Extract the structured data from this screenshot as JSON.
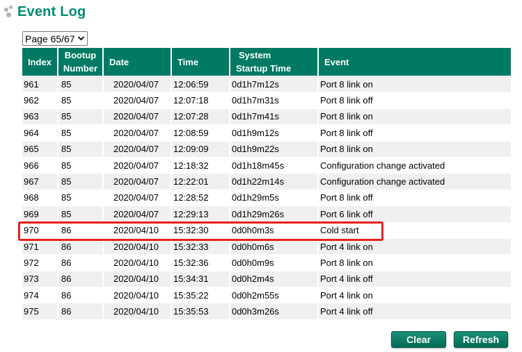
{
  "page": {
    "title": "Event Log"
  },
  "pager": {
    "selected": "Page 65/67"
  },
  "table": {
    "headers": {
      "index": "Index",
      "bootup_1": "Bootup",
      "bootup_2": "Number",
      "date": "Date",
      "time": "Time",
      "system_1": "System",
      "system_2": "Startup Time",
      "event": "Event"
    },
    "rows": [
      {
        "index": "961",
        "bootup": "85",
        "date": "2020/04/07",
        "time": "12:06:59",
        "startup": "0d1h7m12s",
        "event": "Port 8 link on"
      },
      {
        "index": "962",
        "bootup": "85",
        "date": "2020/04/07",
        "time": "12:07:18",
        "startup": "0d1h7m31s",
        "event": "Port 8 link off"
      },
      {
        "index": "963",
        "bootup": "85",
        "date": "2020/04/07",
        "time": "12:07:28",
        "startup": "0d1h7m41s",
        "event": "Port 8 link on"
      },
      {
        "index": "964",
        "bootup": "85",
        "date": "2020/04/07",
        "time": "12:08:59",
        "startup": "0d1h9m12s",
        "event": "Port 8 link off"
      },
      {
        "index": "965",
        "bootup": "85",
        "date": "2020/04/07",
        "time": "12:09:09",
        "startup": "0d1h9m22s",
        "event": "Port 8 link on"
      },
      {
        "index": "966",
        "bootup": "85",
        "date": "2020/04/07",
        "time": "12:18:32",
        "startup": "0d1h18m45s",
        "event": "Configuration change activated"
      },
      {
        "index": "967",
        "bootup": "85",
        "date": "2020/04/07",
        "time": "12:22:01",
        "startup": "0d1h22m14s",
        "event": "Configuration change activated"
      },
      {
        "index": "968",
        "bootup": "85",
        "date": "2020/04/07",
        "time": "12:28:52",
        "startup": "0d1h29m5s",
        "event": "Port 8 link off"
      },
      {
        "index": "969",
        "bootup": "85",
        "date": "2020/04/07",
        "time": "12:29:13",
        "startup": "0d1h29m26s",
        "event": "Port 6 link off"
      },
      {
        "index": "970",
        "bootup": "86",
        "date": "2020/04/10",
        "time": "15:32:30",
        "startup": "0d0h0m3s",
        "event": "Cold start"
      },
      {
        "index": "971",
        "bootup": "86",
        "date": "2020/04/10",
        "time": "15:32:33",
        "startup": "0d0h0m6s",
        "event": "Port 4 link on"
      },
      {
        "index": "972",
        "bootup": "86",
        "date": "2020/04/10",
        "time": "15:32:36",
        "startup": "0d0h0m9s",
        "event": "Port 8 link on"
      },
      {
        "index": "973",
        "bootup": "86",
        "date": "2020/04/10",
        "time": "15:34:31",
        "startup": "0d0h2m4s",
        "event": "Port 4 link off"
      },
      {
        "index": "974",
        "bootup": "86",
        "date": "2020/04/10",
        "time": "15:35:22",
        "startup": "0d0h2m55s",
        "event": "Port 4 link on"
      },
      {
        "index": "975",
        "bootup": "86",
        "date": "2020/04/10",
        "time": "15:35:53",
        "startup": "0d0h3m26s",
        "event": "Port 4 link off"
      }
    ]
  },
  "buttons": {
    "clear": "Clear",
    "refresh": "Refresh"
  },
  "colors": {
    "accent": "#008c72",
    "header_bg": "#007a63",
    "highlight": "#e8201b",
    "stripe": "#f0f0f0"
  }
}
